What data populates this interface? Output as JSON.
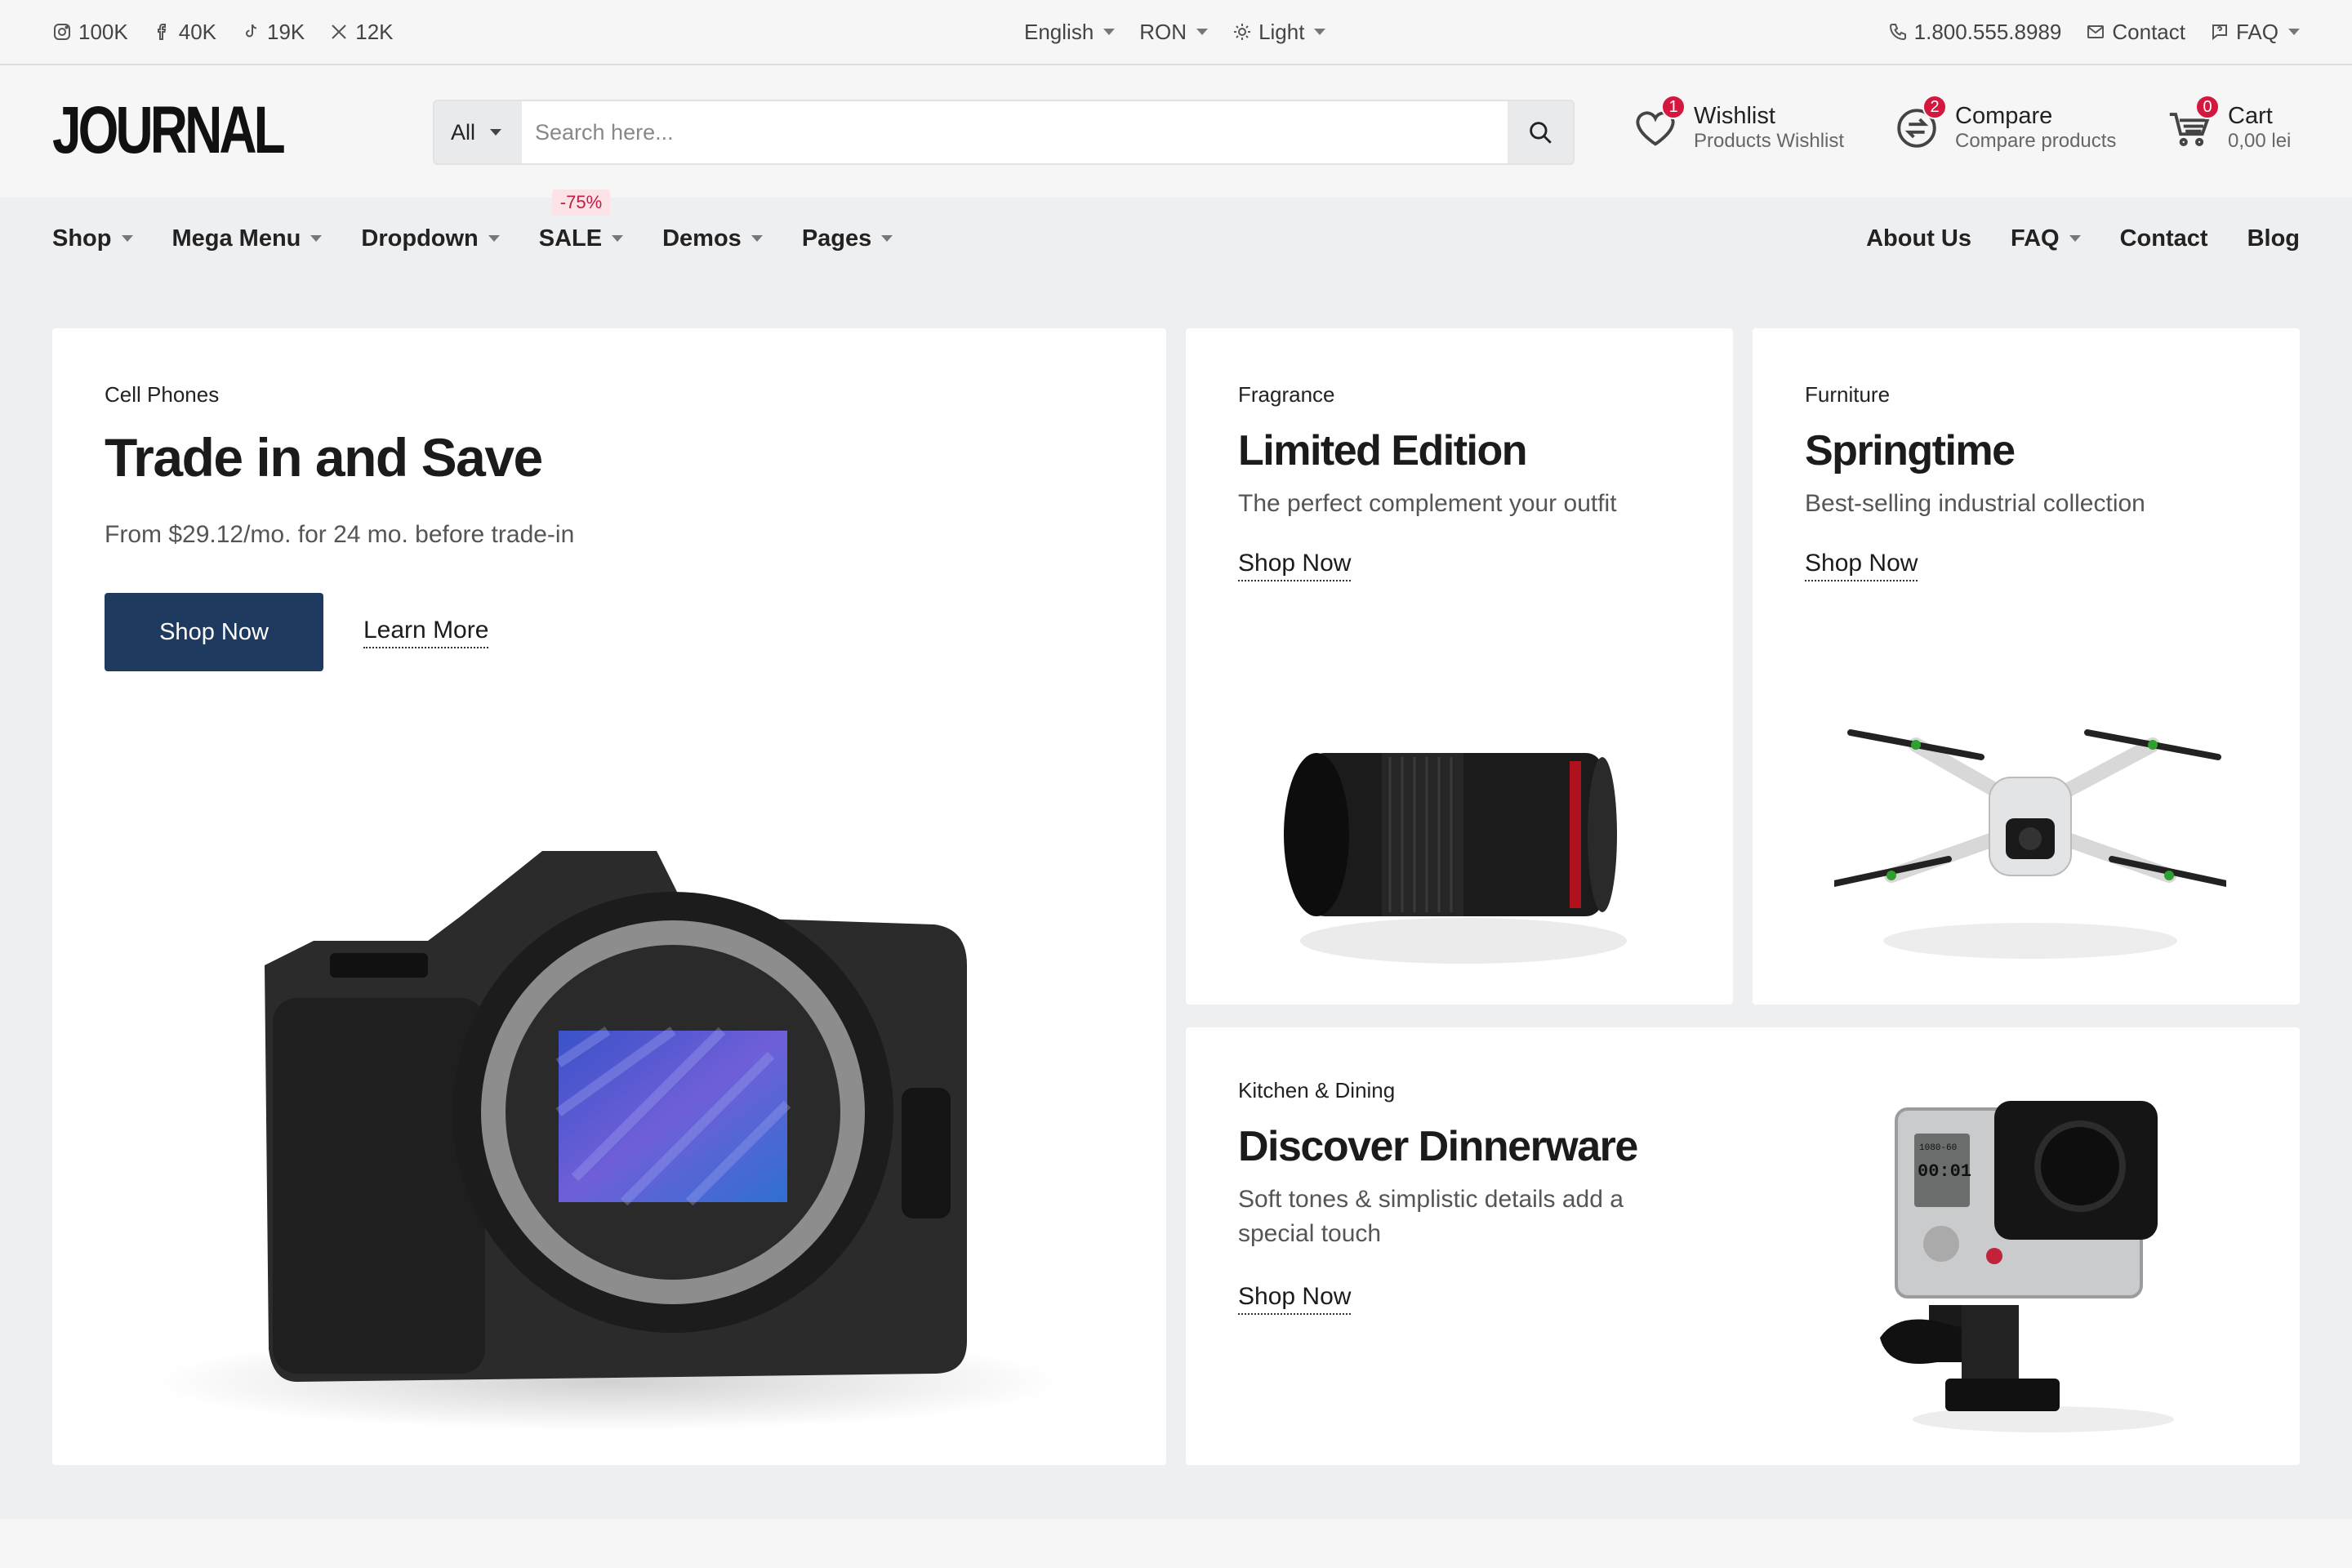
{
  "topbar": {
    "social": [
      {
        "icon": "instagram-icon",
        "count": "100K"
      },
      {
        "icon": "facebook-icon",
        "count": "40K"
      },
      {
        "icon": "tiktok-icon",
        "count": "19K"
      },
      {
        "icon": "x-icon",
        "count": "12K"
      }
    ],
    "language": "English",
    "currency": "RON",
    "theme": "Light",
    "phone": "1.800.555.8989",
    "contact": "Contact",
    "faq": "FAQ"
  },
  "header": {
    "logo": "JOURNAL",
    "search": {
      "category": "All",
      "placeholder": "Search here..."
    },
    "wishlist": {
      "title": "Wishlist",
      "subtitle": "Products Wishlist",
      "count": "1"
    },
    "compare": {
      "title": "Compare",
      "subtitle": "Compare products",
      "count": "2"
    },
    "cart": {
      "title": "Cart",
      "subtitle": "0,00 lei",
      "count": "0"
    }
  },
  "nav": {
    "left": [
      "Shop",
      "Mega Menu",
      "Dropdown",
      "SALE",
      "Demos",
      "Pages"
    ],
    "sale_badge": "-75%",
    "right": [
      "About Us",
      "FAQ",
      "Contact",
      "Blog"
    ]
  },
  "cards": {
    "main": {
      "category": "Cell Phones",
      "title": "Trade in and Save",
      "subtitle": "From $29.12/mo. for 24 mo. before trade-in",
      "primary_button": "Shop Now",
      "secondary_link": "Learn More"
    },
    "fragrance": {
      "category": "Fragrance",
      "title": "Limited Edition",
      "subtitle": "The perfect complement your outfit",
      "link": "Shop Now"
    },
    "furniture": {
      "category": "Furniture",
      "title": "Springtime",
      "subtitle": "Best-selling industrial collection",
      "link": "Shop Now"
    },
    "kitchen": {
      "category": "Kitchen & Dining",
      "title": "Discover Dinnerware",
      "subtitle_line1": "Soft tones & simplistic details add a",
      "subtitle_line2": "special touch",
      "link": "Shop Now",
      "screen_line1": "00:01",
      "screen_top": "1080-60"
    }
  },
  "colors": {
    "accent": "#1f3a5f",
    "badge": "#d3173f",
    "background": "#eeeff1"
  }
}
